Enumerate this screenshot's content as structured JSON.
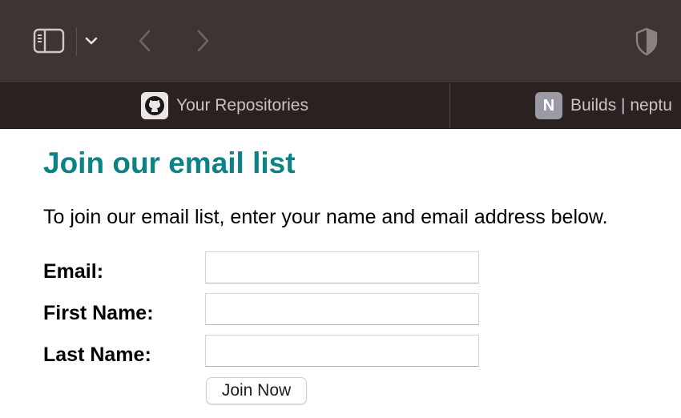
{
  "browser": {
    "toolbar": {
      "icons": [
        "sidebar-icon",
        "chevron-down-icon",
        "back-arrow-icon",
        "forward-arrow-icon",
        "shield-icon"
      ]
    },
    "tabs": [
      {
        "label": "Your Repositories",
        "favicon": "github-icon",
        "active": false
      },
      {
        "label": "Builds | neptu",
        "favicon_letter": "N",
        "active": false
      }
    ],
    "colors": {
      "toolbar_bg": "#3e3432",
      "tabbar_bg": "#2a2221"
    }
  },
  "page": {
    "title": "Join our email list",
    "intro": "To join our email list, enter your name and email address below.",
    "form": {
      "email_label": "Email:",
      "email_value": "",
      "first_name_label": "First Name:",
      "first_name_value": "",
      "last_name_label": "Last Name:",
      "last_name_value": "",
      "submit_label": "Join Now"
    },
    "colors": {
      "title": "#0c8186"
    }
  }
}
